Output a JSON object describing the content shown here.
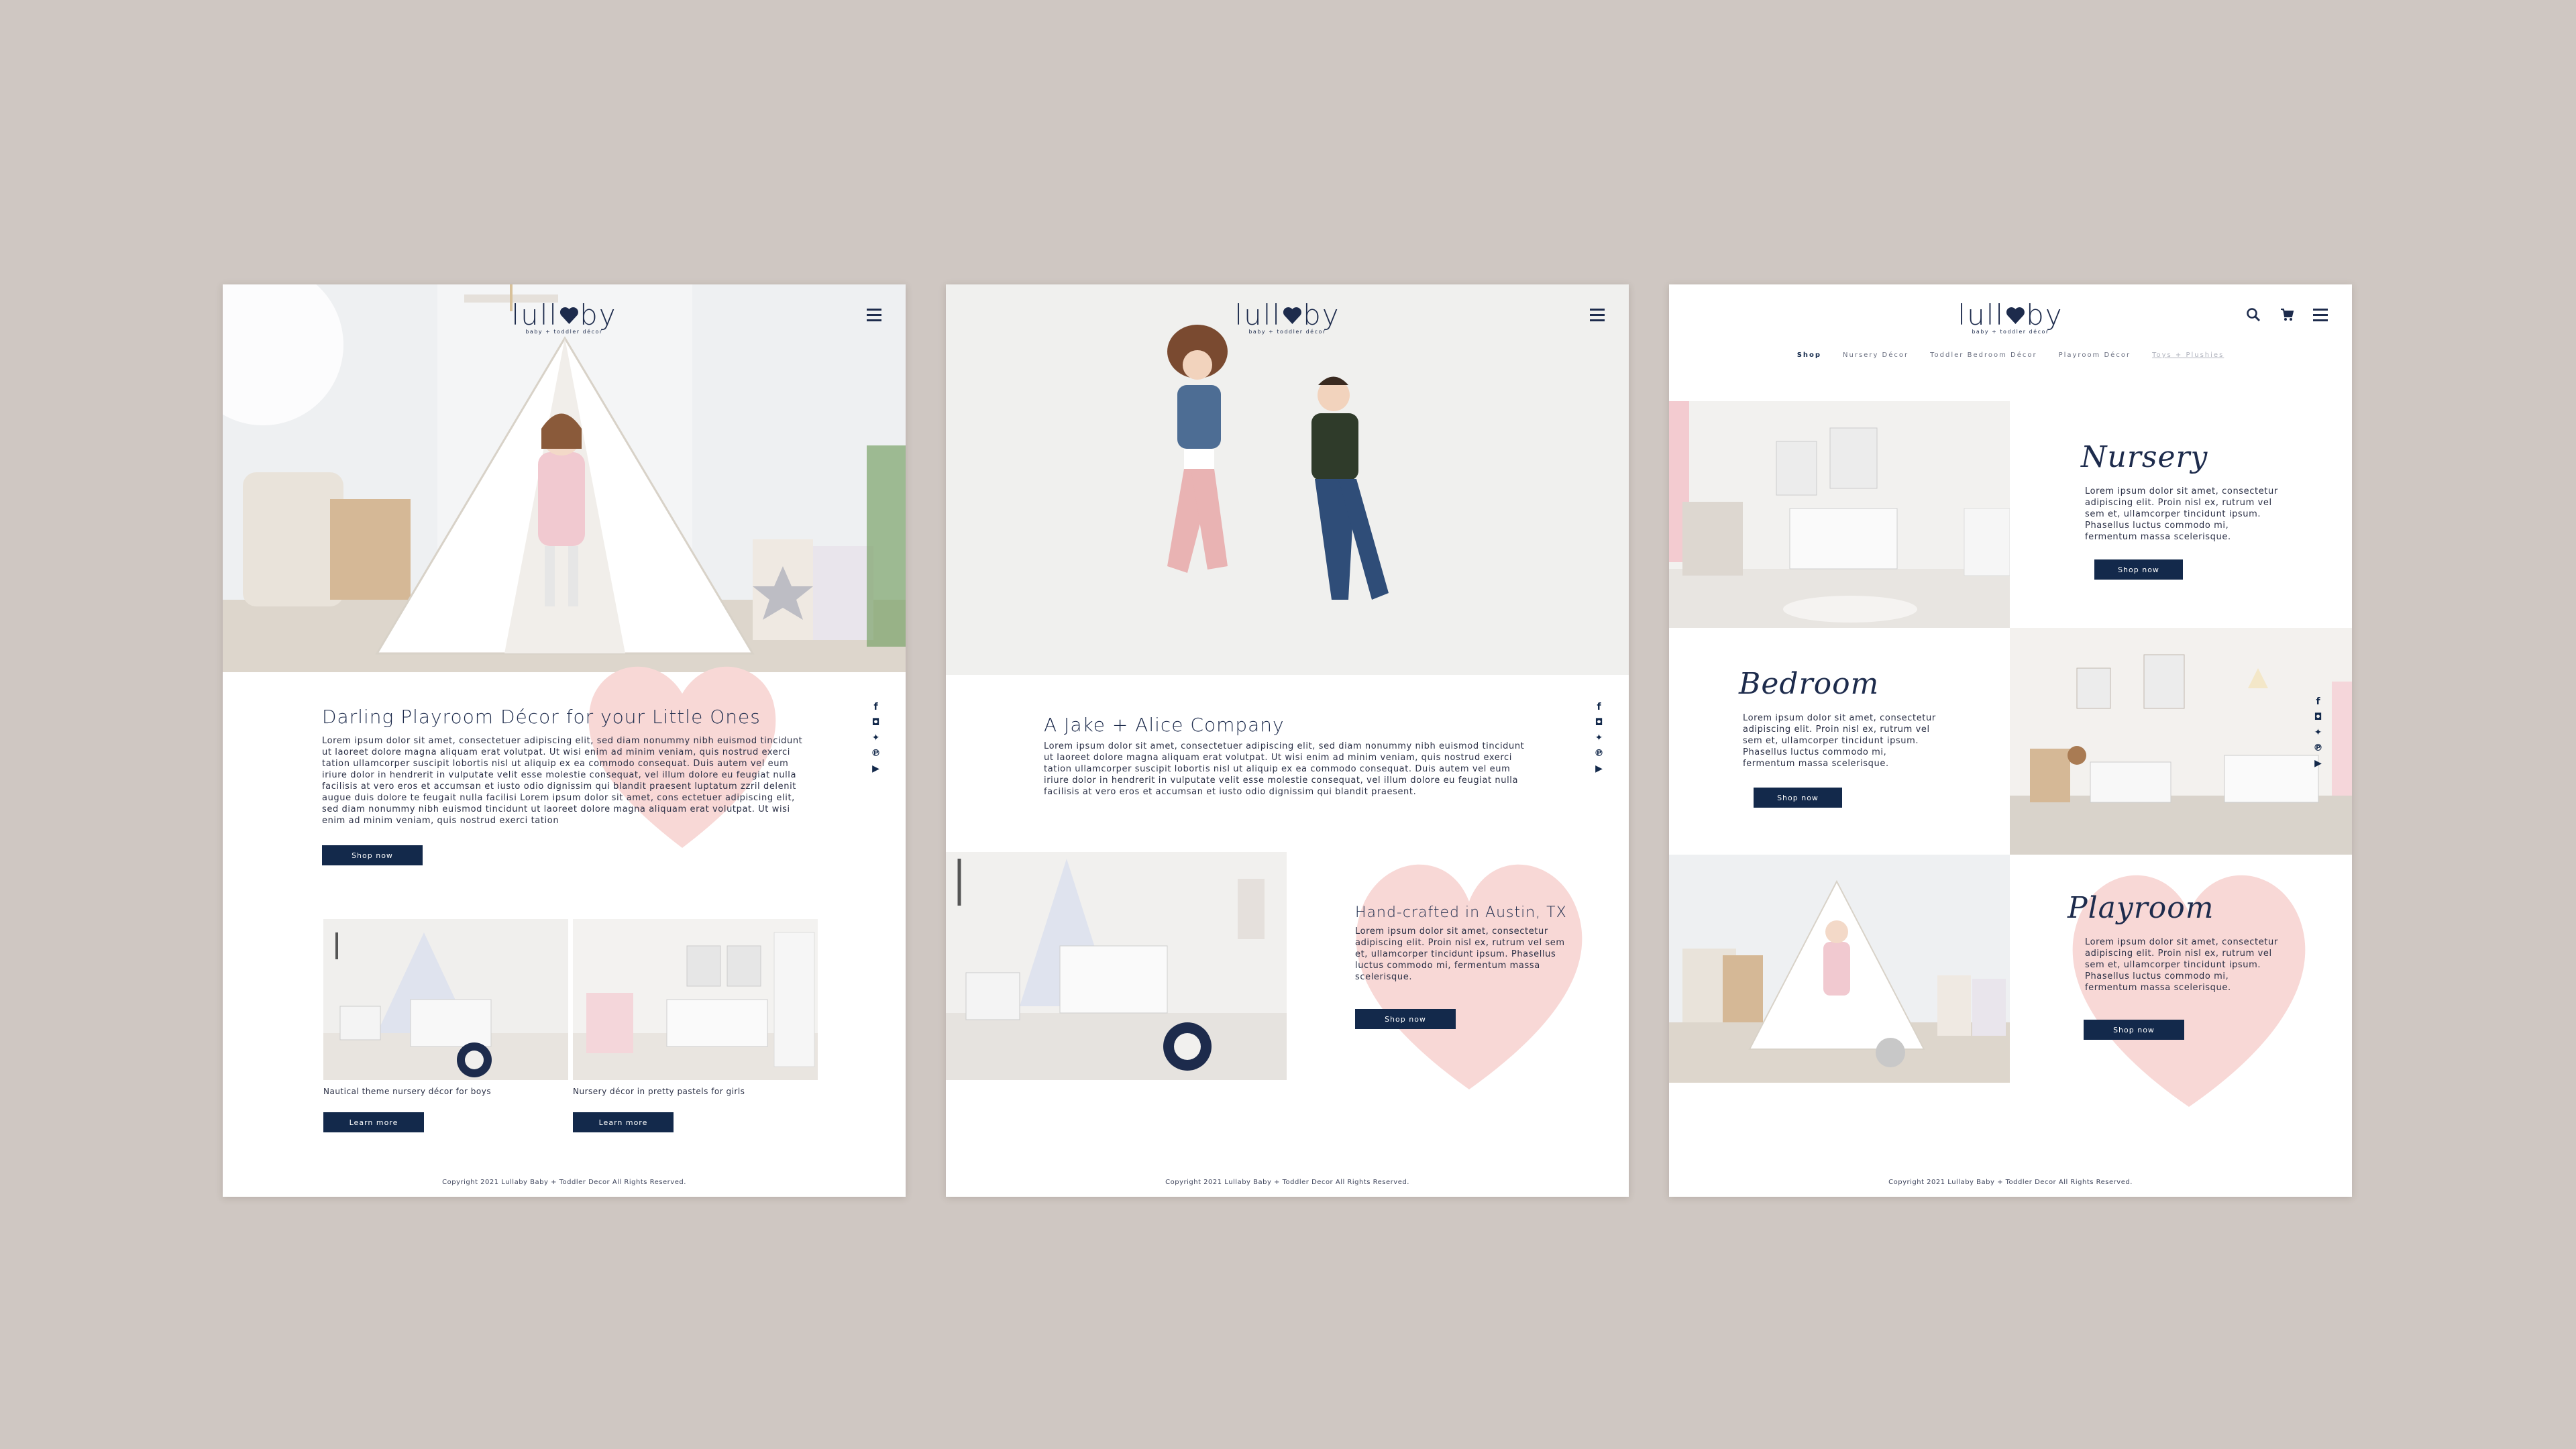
{
  "brand": {
    "name_left": "lull",
    "name_right": "by",
    "tagline": "baby + toddler décor"
  },
  "colors": {
    "navy": "#13294b",
    "blush": "#f8d8d6",
    "background": "#cfc7c2"
  },
  "page1": {
    "headline": "Darling Playroom Décor for your Little Ones",
    "body": "Lorem ipsum dolor sit amet, consectetuer adipiscing elit, sed diam nonummy nibh euismod tincidunt ut laoreet dolore magna aliquam erat volutpat. Ut wisi enim ad minim veniam, quis nostrud exerci tation ullamcorper suscipit lobortis nisl ut aliquip ex ea commodo consequat. Duis autem vel eum iriure dolor in hendrerit in vulputate velit esse molestie consequat, vel illum dolore eu feugiat nulla facilisis at vero eros et accumsan et iusto odio dignissim qui blandit praesent luptatum zzril delenit augue duis dolore te feugait nulla facilisi Lorem ipsum dolor sit amet, cons ectetuer adipiscing elit, sed diam nonummy nibh euismod tincidunt ut laoreet dolore magna aliquam erat volutpat. Ut wisi enim ad minim veniam, quis nostrud exerci tation",
    "cta": "Shop now",
    "card1_caption": "Nautical theme nursery décor for boys",
    "card2_caption": "Nursery décor in pretty pastels for girls",
    "learn_more": "Learn more"
  },
  "page2": {
    "headline": "A Jake + Alice Company",
    "body": "Lorem ipsum dolor sit amet, consectetuer adipiscing elit, sed diam nonummy nibh euismod tincidunt ut laoreet dolore magna aliquam erat volutpat. Ut wisi enim ad minim veniam, quis nostrud exerci tation ullamcorper suscipit lobortis nisl ut aliquip ex ea commodo consequat. Duis autem vel eum iriure dolor in hendrerit in vulputate velit esse molestie consequat, vel illum dolore eu feugiat nulla facilisis at vero eros et accumsan et iusto odio dignissim qui blandit praesent.",
    "feature_title": "Hand-crafted in Austin, TX",
    "feature_body": "Lorem ipsum dolor sit amet, consectetur adipiscing elit. Proin nisl ex, rutrum vel sem et, ullamcorper tincidunt ipsum. Phasellus luctus commodo mi, fermentum massa scelerisque.",
    "cta": "Shop now"
  },
  "page3": {
    "nav": [
      "Shop",
      "Nursery Décor",
      "Toddler Bedroom Décor",
      "Playroom Décor",
      "Toys + Plushies"
    ],
    "sections": [
      {
        "title": "Nursery",
        "body": "Lorem ipsum dolor sit amet, consectetur adipiscing elit. Proin nisl ex, rutrum vel sem et, ullamcorper tincidunt ipsum. Phasellus luctus commodo mi, fermentum massa scelerisque.",
        "cta": "Shop now"
      },
      {
        "title": "Bedroom",
        "body": "Lorem ipsum dolor sit amet, consectetur adipiscing elit. Proin nisl ex, rutrum vel sem et, ullamcorper tincidunt ipsum. Phasellus luctus commodo mi, fermentum massa scelerisque.",
        "cta": "Shop now"
      },
      {
        "title": "Playroom",
        "body": "Lorem ipsum dolor sit amet, consectetur adipiscing elit. Proin nisl ex, rutrum vel sem et, ullamcorper tincidunt ipsum. Phasellus luctus commodo mi, fermentum massa scelerisque.",
        "cta": "Shop now"
      }
    ]
  },
  "footer": "Copyright 2021 Lullaby Baby + Toddler Decor All Rights Reserved.",
  "social_icons": [
    "facebook-icon",
    "instagram-icon",
    "twitter-icon",
    "pinterest-icon",
    "youtube-icon"
  ]
}
